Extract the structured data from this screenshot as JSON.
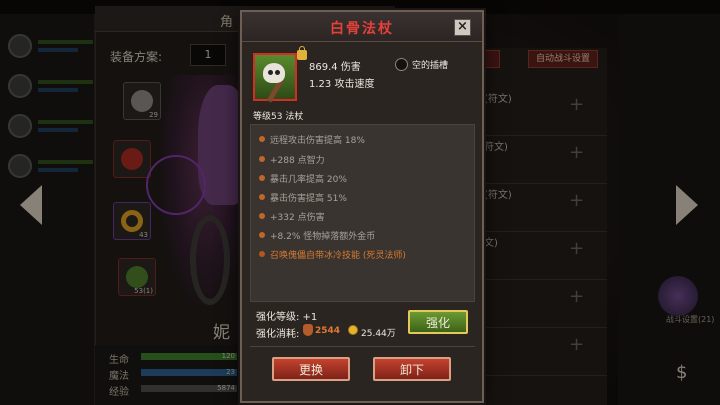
{
  "background": {
    "top_title": "角",
    "equip_plan_label": "装备方案:",
    "equip_plan_value": "1",
    "slots": [
      {
        "level": "29",
        "icon": "helmet-icon"
      },
      {
        "level": "",
        "icon": "armor-icon"
      },
      {
        "level": "43",
        "icon": "ring-icon"
      },
      {
        "level": "53(1)",
        "icon": "staff-icon"
      }
    ],
    "name_fragment": "妮",
    "stats": [
      {
        "label": "生命",
        "value": "120",
        "color": "#3b7a2a"
      },
      {
        "label": "魔法",
        "value": "23",
        "color": "#2a5f8a"
      },
      {
        "label": "经验",
        "value": "5874",
        "color": "#4a4a4a"
      }
    ],
    "auto_battle_button": "自动战斗设置",
    "rune_rows": [
      "(符文)",
      "符文)",
      "(符文)",
      "文)",
      "",
      "",
      ""
    ],
    "battle_settings_label": "战斗设置(21)"
  },
  "modal": {
    "title": "白骨法杖",
    "item_icon": "skull-staff-icon",
    "damage": "869.4 伤害",
    "attack_speed": "1.23 攻击速度",
    "socket_label": "空的插槽",
    "level_line": "等级53  法杖",
    "attributes": [
      "远程攻击伤害提高 18%",
      "+288 点智力",
      "暴击几率提高 20%",
      "暴击伤害提高 51%",
      "+332 点伤害",
      "+8.2% 怪物掉落额外金币"
    ],
    "special_attribute": "召唤傀儡自带冰冷技能 (死灵法师)",
    "enhance_level_label": "强化等级:  +1",
    "enhance_cost_label": "强化消耗:",
    "cost_material": "2544",
    "cost_gold": "25.44万",
    "enhance_button": "强化",
    "replace_button": "更换",
    "unequip_button": "卸下",
    "close_symbol": "×",
    "colors": {
      "title": "#e5413a",
      "special": "#d4792f",
      "enhance": "#4a7a22",
      "action": "#a83224"
    }
  }
}
